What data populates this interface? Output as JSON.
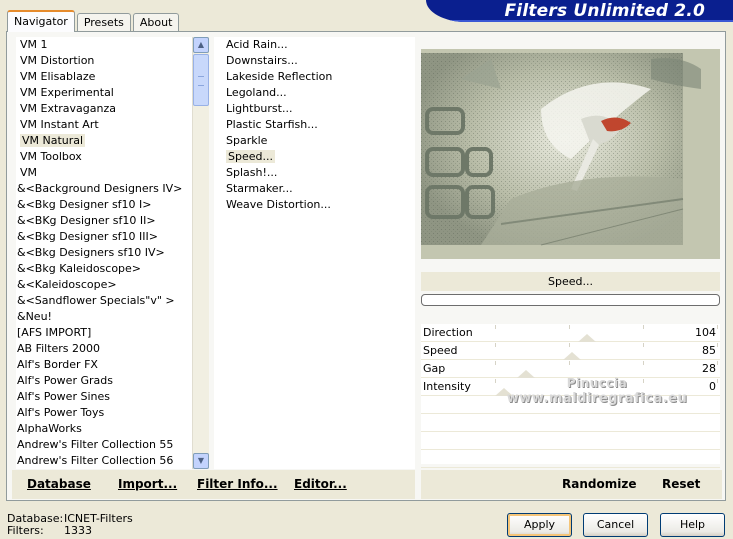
{
  "window": {
    "title": "Filters Unlimited 2.0"
  },
  "tabs": [
    {
      "label": "Navigator",
      "active": true
    },
    {
      "label": "Presets",
      "active": false
    },
    {
      "label": "About",
      "active": false
    }
  ],
  "categories": {
    "selected": "VM Natural",
    "items": [
      "VM 1",
      "VM Distortion",
      "VM Elisablaze",
      "VM Experimental",
      "VM Extravaganza",
      "VM Instant Art",
      "VM Natural",
      "VM Toolbox",
      "VM",
      "&<Background Designers IV>",
      "&<Bkg Designer sf10 I>",
      "&<BKg Designer sf10 II>",
      "&<Bkg Designer sf10 III>",
      "&<Bkg Designers sf10 IV>",
      "&<Bkg Kaleidoscope>",
      "&<Kaleidoscope>",
      "&<Sandflower Specials\"v\" >",
      "&Neu!",
      "[AFS IMPORT]",
      "AB Filters 2000",
      "Alf's Border FX",
      "Alf's Power Grads",
      "Alf's Power Sines",
      "Alf's Power Toys",
      "AlphaWorks",
      "Andrew's Filter Collection 55",
      "Andrew's Filter Collection 56"
    ]
  },
  "filters": {
    "selected": "Speed...",
    "items": [
      "Acid Rain...",
      "Downstairs...",
      "Lakeside Reflection",
      "Legoland...",
      "Lightburst...",
      "Plastic Starfish...",
      "Sparkle",
      "Speed...",
      "Splash!...",
      "Starmaker...",
      "Weave Distortion..."
    ]
  },
  "bottom_buttons": {
    "database": "Database",
    "import": "Import...",
    "filter_info": "Filter Info...",
    "editor": "Editor..."
  },
  "preview": {
    "filter_name": "Speed...",
    "progress": 0
  },
  "parameters": [
    {
      "name": "Direction",
      "value": 104
    },
    {
      "name": "Speed",
      "value": 85
    },
    {
      "name": "Gap",
      "value": 28
    },
    {
      "name": "Intensity",
      "value": 0
    }
  ],
  "watermark": {
    "line1": "Pinuccia",
    "line2": "www.maldiregrafica.eu"
  },
  "right_buttons": {
    "randomize": "Randomize",
    "reset": "Reset"
  },
  "status": {
    "database_label": "Database:",
    "database_value": "ICNET-Filters",
    "filters_label": "Filters:",
    "filters_value": "1333"
  },
  "dialog_buttons": {
    "apply": "Apply",
    "cancel": "Cancel",
    "help": "Help"
  }
}
